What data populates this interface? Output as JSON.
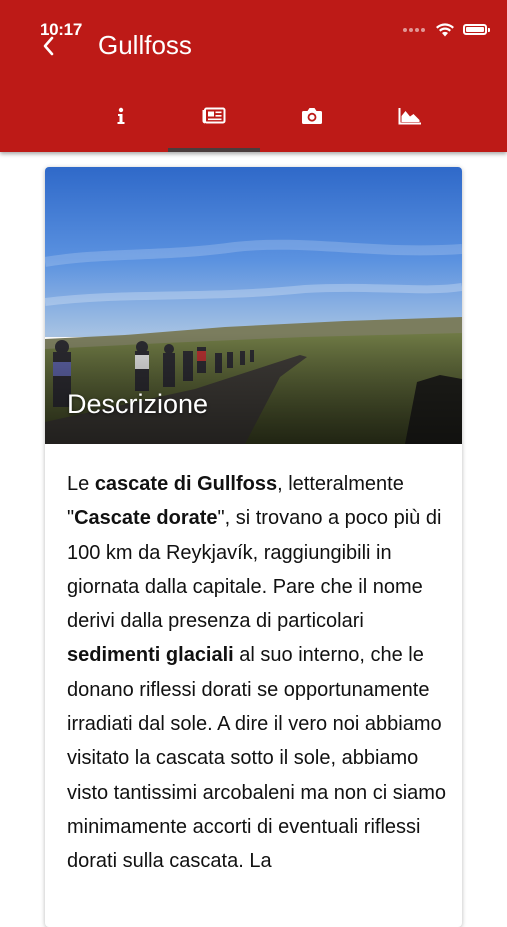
{
  "status_bar": {
    "time": "10:17",
    "icons": [
      "signal-icon",
      "wifi-icon",
      "battery-icon"
    ]
  },
  "appbar": {
    "title": "Gullfoss",
    "back_icon": "chevron-left-icon",
    "background": "#bd1a17"
  },
  "tabs": [
    {
      "icon": "info-icon",
      "selected": false
    },
    {
      "icon": "newspaper-icon",
      "selected": true
    },
    {
      "icon": "camera-icon",
      "selected": false
    },
    {
      "icon": "chart-area-icon",
      "selected": false
    }
  ],
  "card": {
    "image_caption": "Descrizione",
    "description": [
      {
        "t": "Le ",
        "b": false
      },
      {
        "t": "cascate di Gullfoss",
        "b": true
      },
      {
        "t": ", letteralmente \"",
        "b": false
      },
      {
        "t": "Cascate dorate",
        "b": true
      },
      {
        "t": "\", si trovano a poco più di 100 km da Reykjavík, raggiungibili in giornata dalla capitale. Pare che il nome derivi dalla presenza di particolari ",
        "b": false
      },
      {
        "t": "sedimenti glaciali",
        "b": true
      },
      {
        "t": " al suo interno, che le donano riflessi dorati se opportunamente irradiati dal sole. A dire il vero noi abbiamo visitato la cascata sotto il sole, abbiamo visto tantissimi arcobaleni ma non ci siamo minimamente accorti di eventuali riflessi dorati sulla cascata. La",
        "b": false
      }
    ]
  }
}
